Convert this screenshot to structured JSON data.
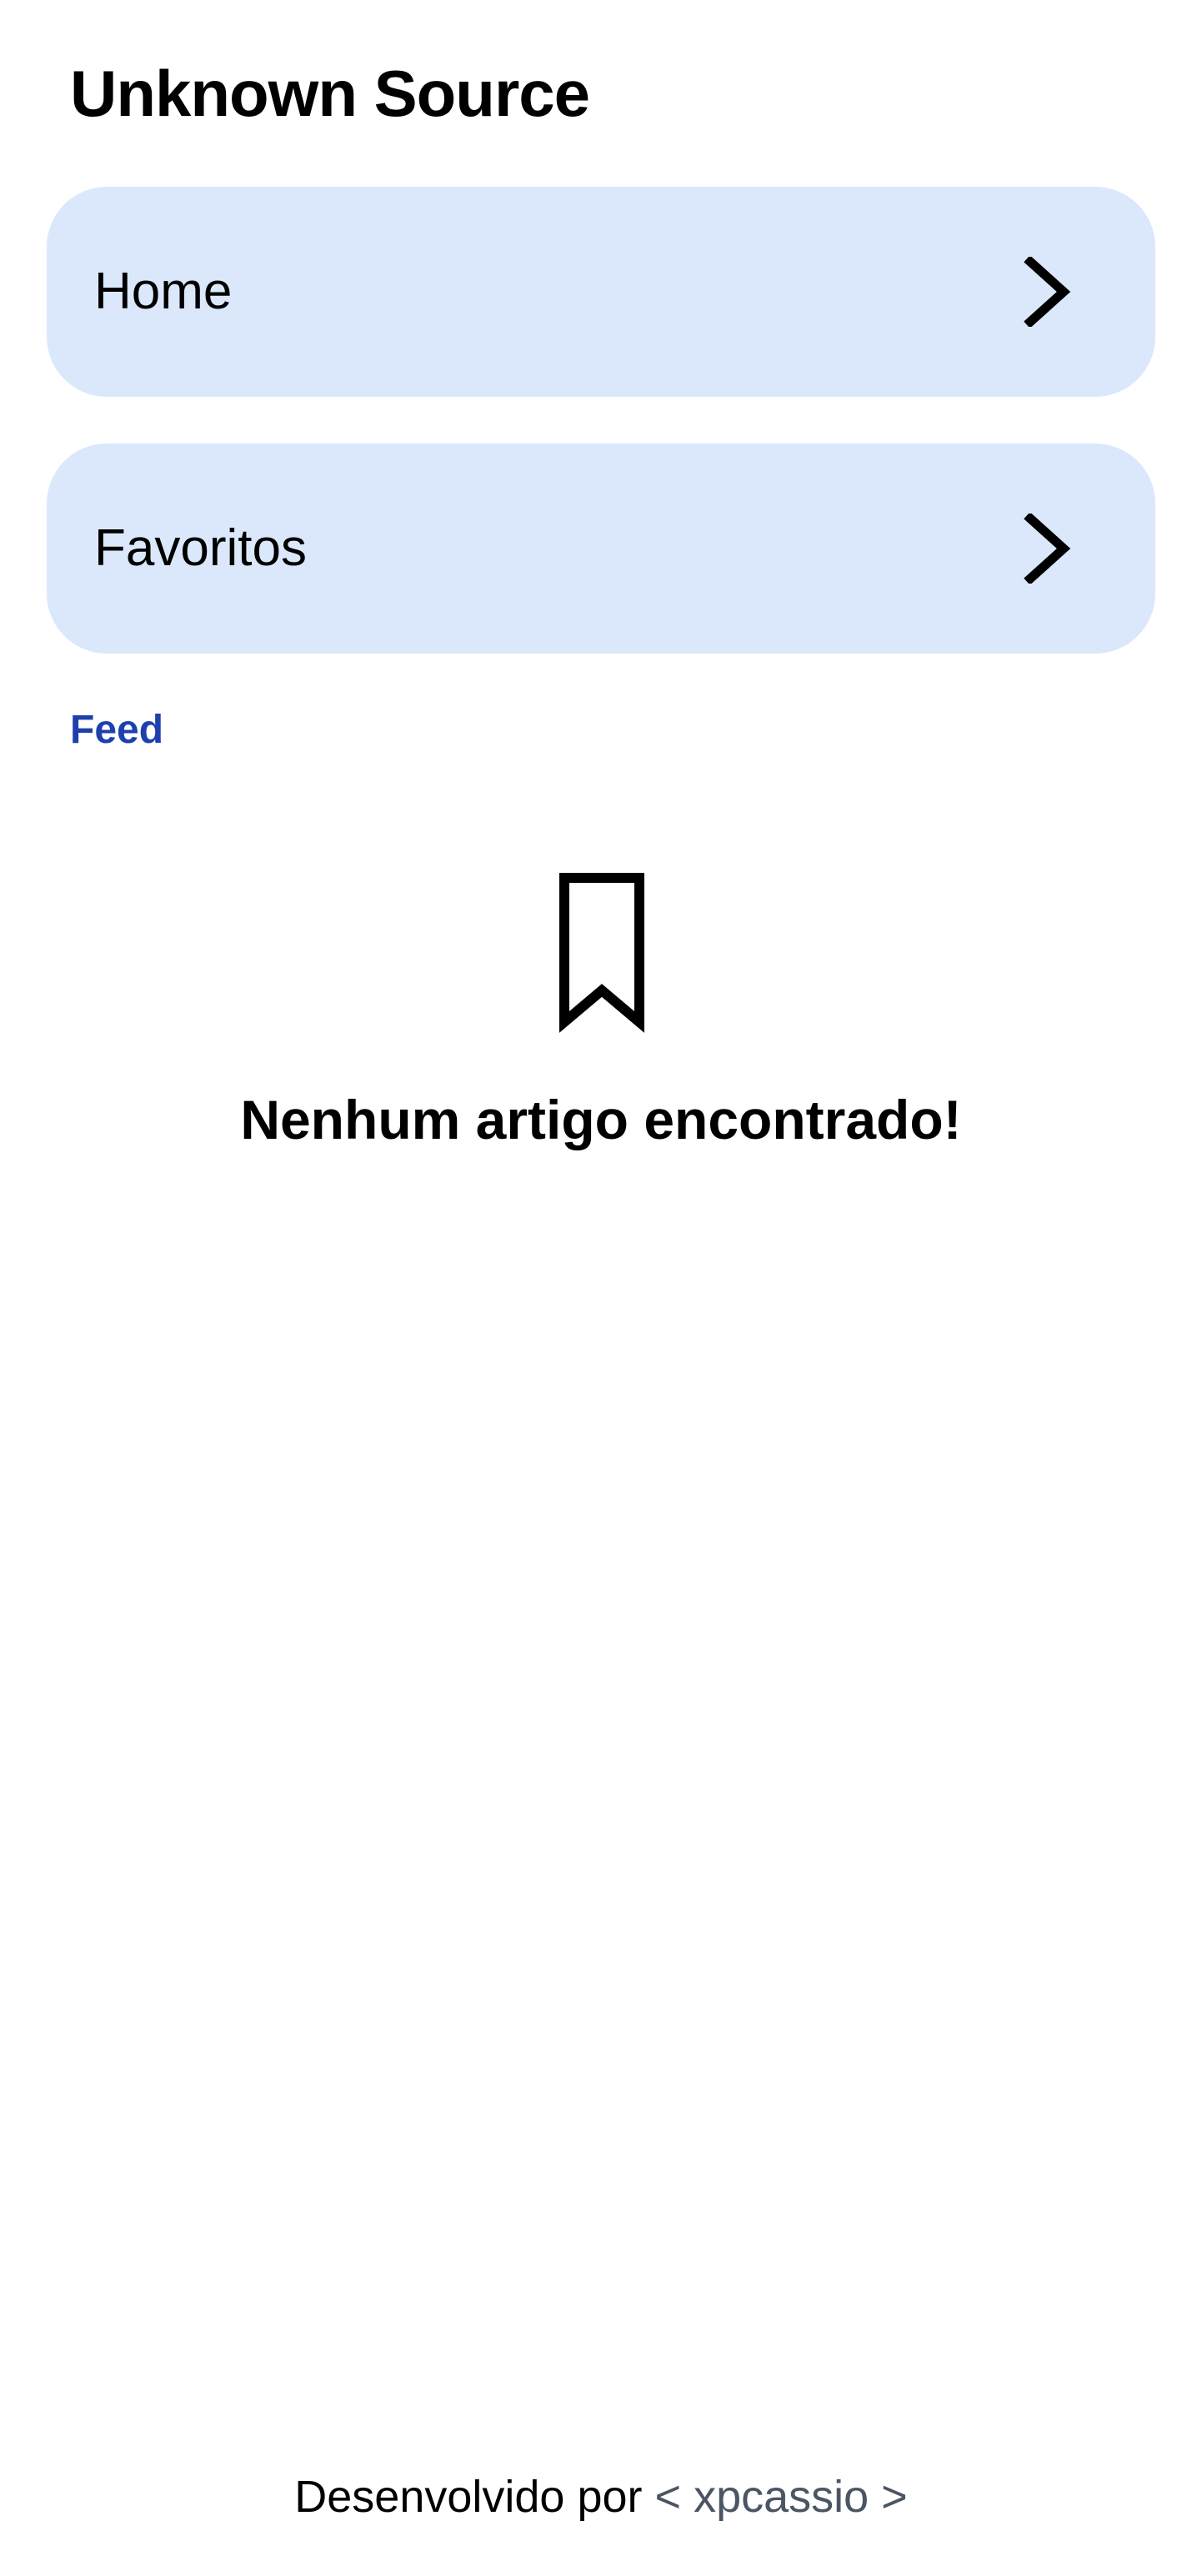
{
  "header": {
    "title": "Unknown Source"
  },
  "nav": {
    "items": [
      {
        "label": "Home",
        "icon": "chevron-right-icon"
      },
      {
        "label": "Favoritos",
        "icon": "chevron-right-icon"
      }
    ]
  },
  "section": {
    "label": "Feed"
  },
  "empty_state": {
    "icon": "bookmark-icon",
    "message": "Nenhum artigo encontrado!"
  },
  "footer": {
    "prefix": "Desenvolvido por",
    "author": "< xpcassio >"
  },
  "colors": {
    "card_background": "#dbe8fc",
    "section_label": "#1e40af",
    "footer_link": "#4b5563",
    "text": "#000000",
    "background": "#ffffff"
  }
}
